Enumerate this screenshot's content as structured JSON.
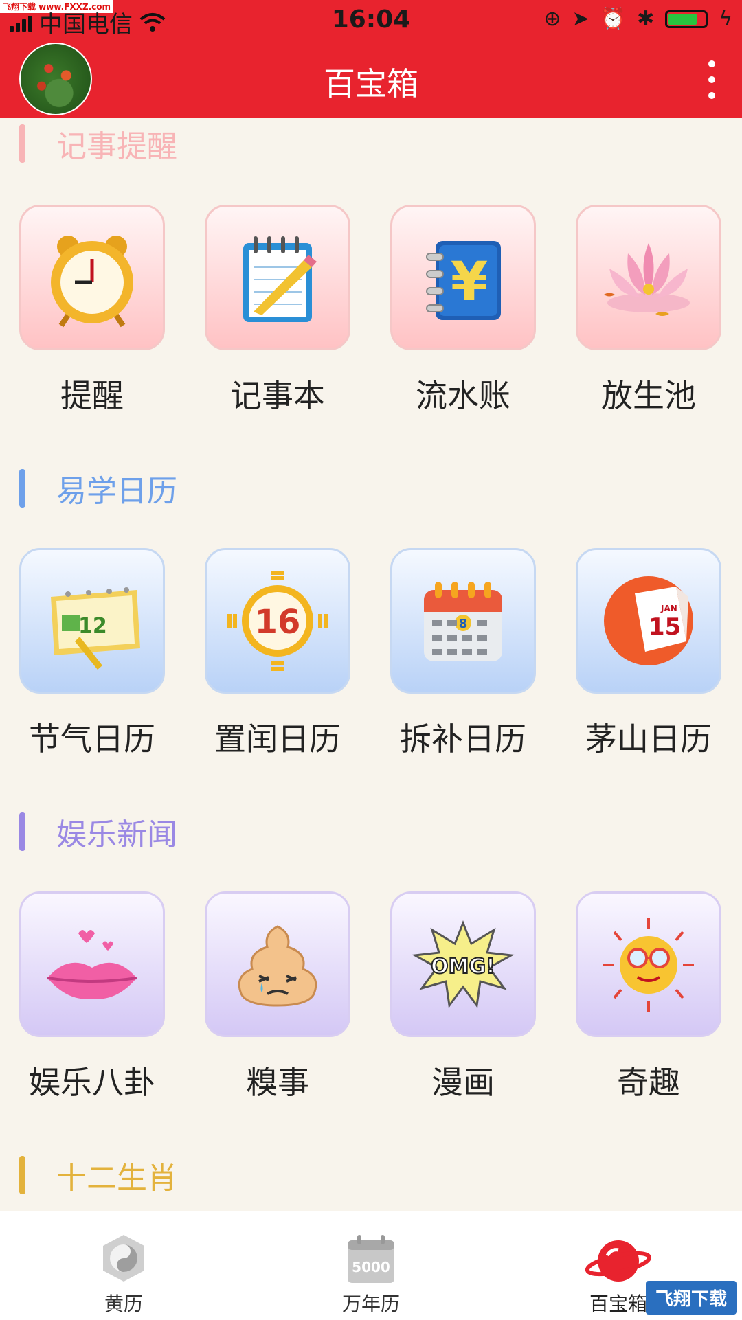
{
  "status": {
    "carrier": "中国电信",
    "time": "16:04",
    "watermark": "飞翔下载 www.FXXZ.com"
  },
  "header": {
    "title": "百宝箱"
  },
  "sections": [
    {
      "title": "记事提醒",
      "color": "#f8b4b6",
      "items": [
        {
          "label": "提醒",
          "icon": "alarm-clock-icon"
        },
        {
          "label": "记事本",
          "icon": "notepad-pencil-icon"
        },
        {
          "label": "流水账",
          "icon": "yen-ledger-icon"
        },
        {
          "label": "放生池",
          "icon": "lotus-icon"
        }
      ]
    },
    {
      "title": "易学日历",
      "color": "#6ea0ea",
      "items": [
        {
          "label": "节气日历",
          "icon": "solar-term-calendar-icon"
        },
        {
          "label": "置闰日历",
          "icon": "bagua-16-icon"
        },
        {
          "label": "拆补日历",
          "icon": "desk-calendar-8-icon"
        },
        {
          "label": "茅山日历",
          "icon": "jan-15-calendar-icon"
        }
      ]
    },
    {
      "title": "娱乐新闻",
      "color": "#9a88e4",
      "items": [
        {
          "label": "娱乐八卦",
          "icon": "lips-icon"
        },
        {
          "label": "糗事",
          "icon": "crying-poop-icon"
        },
        {
          "label": "漫画",
          "icon": "omg-comic-icon"
        },
        {
          "label": "奇趣",
          "icon": "sun-sunglasses-icon"
        }
      ]
    },
    {
      "title": "十二生肖",
      "color": "#e3b23c"
    }
  ],
  "tabs": [
    {
      "label": "黄历",
      "icon": "yin-yang-icon"
    },
    {
      "label": "万年历",
      "icon": "calendar-5000-icon",
      "icon_text": "5000"
    },
    {
      "label": "百宝箱",
      "icon": "planet-icon"
    }
  ],
  "watermark_bottom": "飞翔下载"
}
